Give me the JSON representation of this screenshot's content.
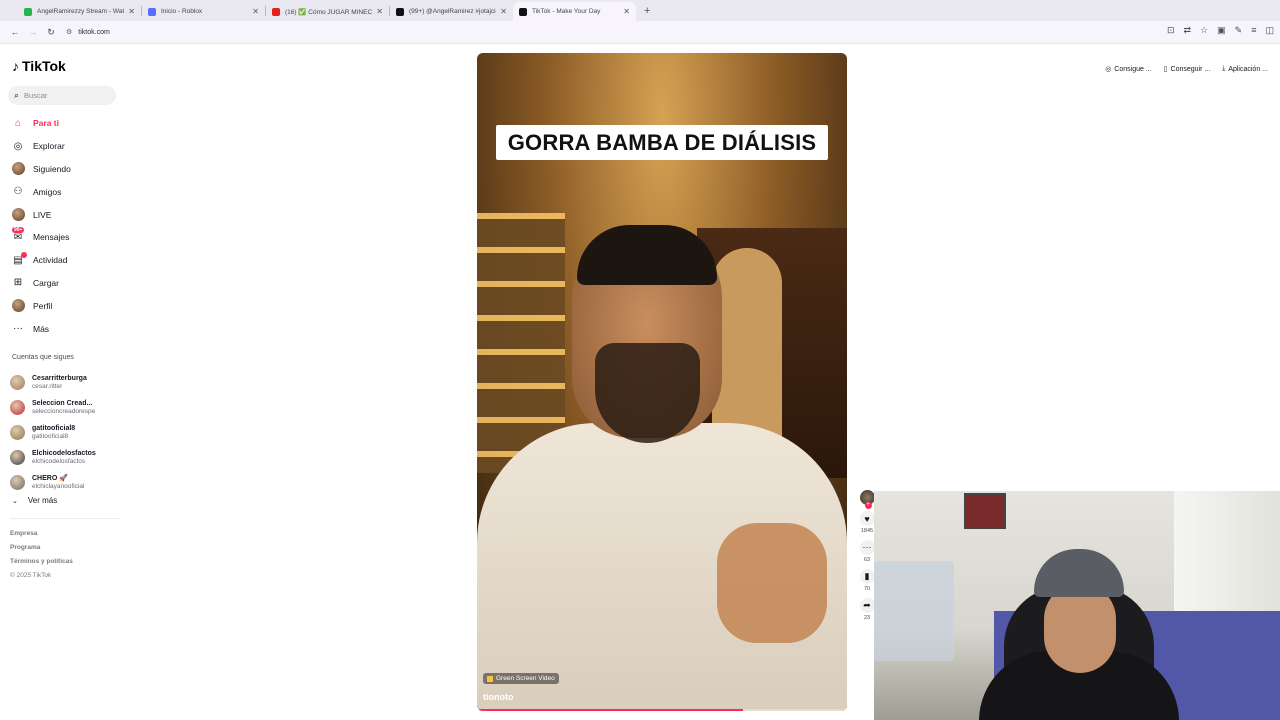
{
  "browser": {
    "tabs": [
      {
        "title": "AngelRamirezzy Stream - Watc",
        "color": "#2bb24c",
        "active": false
      },
      {
        "title": "Inicio - Roblox",
        "color": "#5b6cff",
        "active": false
      },
      {
        "title": "(16) ✅ Cómo JUGAR MINECR",
        "color": "#e62117",
        "active": false
      },
      {
        "title": "(99+) @AngelRamirez #jotajcid",
        "color": "#111111",
        "active": false
      },
      {
        "title": "TikTok - Make Your Day",
        "color": "#111111",
        "active": true
      }
    ],
    "new_tab": "+",
    "url": "tiktok.com"
  },
  "sidebar": {
    "logo": "TikTok",
    "search_placeholder": "Buscar",
    "nav": [
      {
        "label": "Para ti",
        "icon": "home-icon",
        "active": true
      },
      {
        "label": "Explorar",
        "icon": "compass-icon",
        "active": false
      },
      {
        "label": "Siguiendo",
        "icon": "following-avatar-icon",
        "active": false
      },
      {
        "label": "Amigos",
        "icon": "friends-icon",
        "active": false
      },
      {
        "label": "LIVE",
        "icon": "live-icon",
        "active": false
      },
      {
        "label": "Mensajes",
        "icon": "messages-icon",
        "active": false,
        "badge": "99+"
      },
      {
        "label": "Actividad",
        "icon": "activity-icon",
        "active": false
      },
      {
        "label": "Cargar",
        "icon": "upload-icon",
        "active": false
      },
      {
        "label": "Perfil",
        "icon": "profile-icon",
        "active": false
      },
      {
        "label": "Más",
        "icon": "more-icon",
        "active": false
      }
    ],
    "following_title": "Cuentas que sigues",
    "following": [
      {
        "name": "Cesarritterburga",
        "user": "cesar.ritter",
        "color": "#a07a5a"
      },
      {
        "name": "Seleccion Cread...",
        "user": "seleccioncreadorespe",
        "color": "#c0282d"
      },
      {
        "name": "gatitooficial8",
        "user": "gatitooficial8",
        "color": "#8a7a4a"
      },
      {
        "name": "Elchicodelosfactos",
        "user": "elchicodelosfactos",
        "color": "#3a3a3a"
      },
      {
        "name": "CHERO 🚀",
        "user": "elchiclayanooficial",
        "color": "#6a6a6a"
      }
    ],
    "see_more": "Ver más",
    "footer": [
      "Empresa",
      "Programa",
      "Términos y políticas"
    ],
    "copyright": "© 2025 TikTok"
  },
  "topright": [
    {
      "label": "Consigue ...",
      "icon": "coin-icon"
    },
    {
      "label": "Conseguir ...",
      "icon": "tablet-icon"
    },
    {
      "label": "Aplicación ...",
      "icon": "download-icon"
    }
  ],
  "video": {
    "caption": "GORRA BAMBA DE DIÁLISIS",
    "effect_label": "Green Screen Video",
    "author": "tionoto",
    "progress": 0.72
  },
  "actions": [
    {
      "icon": "heart-icon",
      "count": "1845"
    },
    {
      "icon": "comment-icon",
      "count": "63"
    },
    {
      "icon": "bookmark-icon",
      "count": "70"
    },
    {
      "icon": "share-icon",
      "count": "23"
    }
  ],
  "colors": {
    "accent": "#fe2c55"
  }
}
